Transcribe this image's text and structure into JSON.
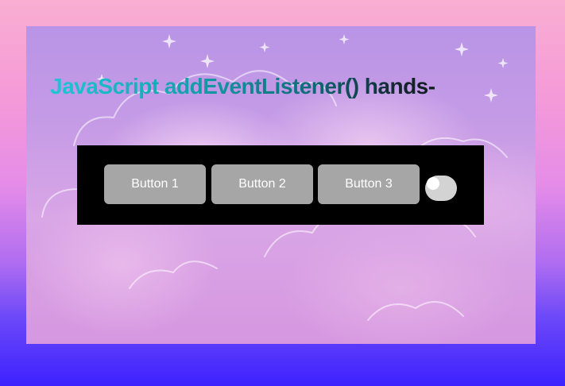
{
  "page": {
    "title": "JavaScript addEventListener() hands-"
  },
  "controls": {
    "buttons": [
      {
        "label": "Button 1"
      },
      {
        "label": "Button 2"
      },
      {
        "label": "Button 3"
      }
    ],
    "toggle": {
      "state": "off"
    }
  },
  "colors": {
    "page_gradient_top": "#f9aed2",
    "page_gradient_bottom": "#3d22ff",
    "panel_background": "#000000",
    "button_background": "#a6a6a6",
    "button_text": "#ffffff",
    "title_gradient_start": "#1ec6d6",
    "title_gradient_end": "#111111",
    "toggle_track": "#d3d3d3"
  }
}
